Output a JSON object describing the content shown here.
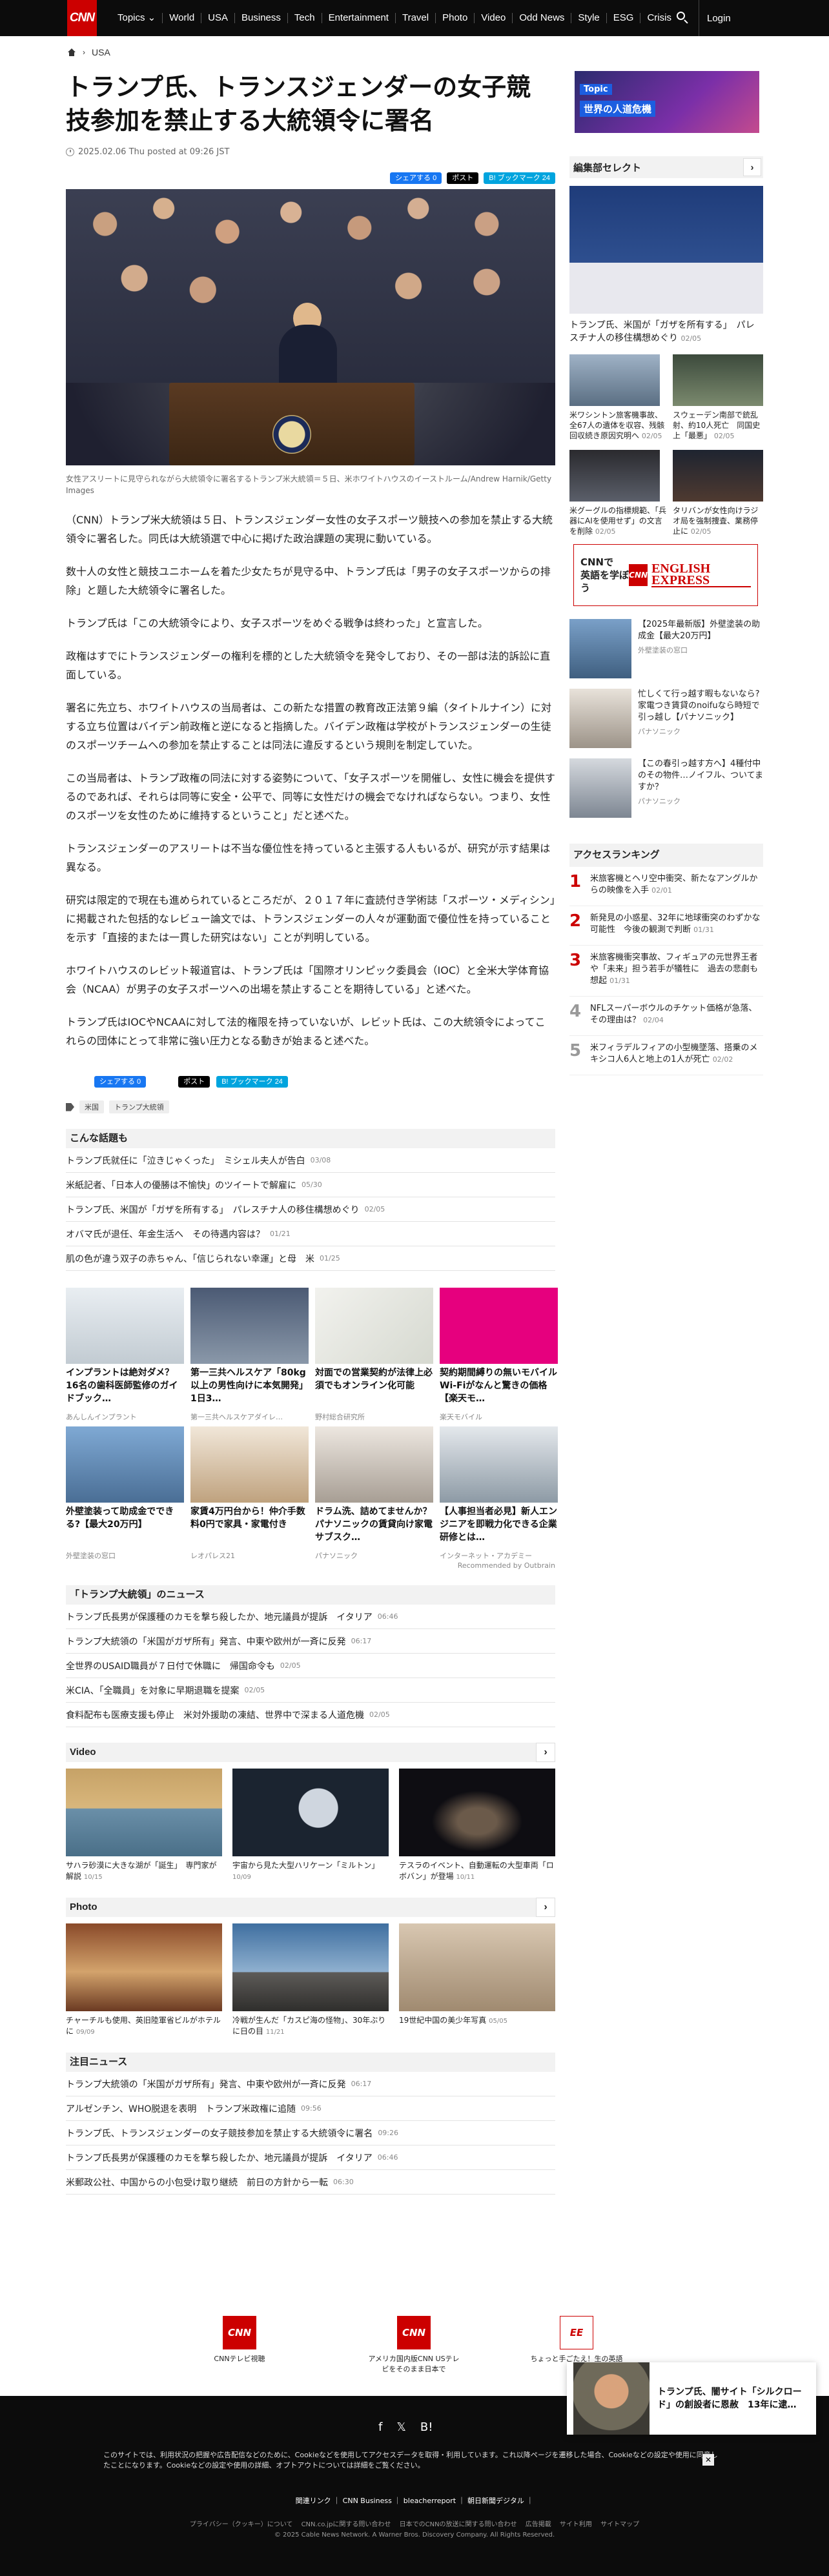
{
  "nav": {
    "logo": "CNN",
    "items": [
      "Topics ⌄",
      "World",
      "USA",
      "Business",
      "Tech",
      "Entertainment",
      "Travel",
      "Photo",
      "Video",
      "Odd News",
      "Style",
      "ESG",
      "Crisis"
    ],
    "login": "Login"
  },
  "breadcrumb": {
    "section": "USA"
  },
  "article": {
    "title": "トランプ氏、トランスジェンダーの女子競技参加を禁止する大統領令に署名",
    "date": "2025.02.06 Thu posted at 09:26 JST",
    "share": {
      "facebook": "シェアする 0",
      "x": "ポスト",
      "hatena": "B! ブックマーク 24"
    },
    "caption": "女性アスリートに見守られながら大統領令に署名するトランプ米大統領＝５日、米ホワイトハウスのイーストルーム/Andrew Harnik/Getty Images",
    "paragraphs": [
      "（CNN）トランプ米大統領は５日、トランスジェンダー女性の女子スポーツ競技への参加を禁止する大統領令に署名した。同氏は大統領選で中心に掲げた政治課題の実現に動いている。",
      "数十人の女性と競技ユニホームを着た少女たちが見守る中、トランプ氏は「男子の女子スポーツからの排除」と題した大統領令に署名した。",
      "トランプ氏は「この大統領令により、女子スポーツをめぐる戦争は終わった」と宣言した。",
      "政権はすでにトランスジェンダーの権利を標的とした大統領令を発令しており、その一部は法的訴訟に直面している。",
      "署名に先立ち、ホワイトハウスの当局者は、この新たな措置の教育改正法第９編（タイトルナイン）に対する立ち位置はバイデン前政権と逆になると指摘した。バイデン政権は学校がトランスジェンダーの生徒のスポーツチームへの参加を禁止することは同法に違反するという規則を制定していた。",
      "この当局者は、トランプ政権の同法に対する姿勢について、「女子スポーツを開催し、女性に機会を提供するのであれば、それらは同等に安全・公平で、同等に女性だけの機会でなければならない。つまり、女性のスポーツを女性のために維持するということ」だと述べた。",
      "トランスジェンダーのアスリートは不当な優位性を持っていると主張する人もいるが、研究が示す結果は異なる。",
      "研究は限定的で現在も進められているところだが、２０１７年に査読付き学術誌「スポーツ・メディシン」に掲載された包括的なレビュー論文では、トランスジェンダーの人々が運動面で優位性を持っていることを示す「直接的または一貫した研究はない」ことが判明している。",
      "ホワイトハウスのレビット報道官は、トランプ氏は「国際オリンピック委員会（IOC）と全米大学体育協会（NCAA）が男子の女子スポーツへの出場を禁止することを期待している」と述べた。",
      "トランプ氏はIOCやNCAAに対して法的権限を持っていないが、レビット氏は、この大統領令によってこれらの団体にとって非常に強い圧力となる動きが始まると述べた。"
    ],
    "share2": {
      "facebook": "シェアする 0",
      "x": "ポスト",
      "hatena": "B! ブックマーク 24"
    },
    "tags": [
      "米国",
      "トランプ大統領"
    ]
  },
  "popular": {
    "heading": "こんな話題も",
    "items": [
      {
        "text": "トランプ氏就任に「泣きじゃくった」　ミシェル夫人が告白",
        "date": "03/08"
      },
      {
        "text": "米紙記者、「日本人の優勝は不愉快」のツイートで解雇に",
        "date": "05/30"
      },
      {
        "text": "トランプ氏、米国が「ガザを所有する」　パレスチナ人の移住構想めぐり",
        "date": "02/05"
      },
      {
        "text": "オバマ氏が退任、年金生活へ　その待遇内容は？",
        "date": "01/21"
      },
      {
        "text": "肌の色が違う双子の赤ちゃん、「信じられない幸運」と母　米",
        "date": "01/25"
      }
    ]
  },
  "ads": [
    {
      "title": "インプラントは絶対ダメ？16名の歯科医師監修のガイドブック…",
      "sponsor": "あんしんインプラント"
    },
    {
      "title": "第一三共ヘルスケア「80kg以上の男性向けに本気開発」1日3…",
      "sponsor": "第一三共ヘルスケアダイレ…"
    },
    {
      "title": "対面での営業契約が法律上必須でもオンライン化可能",
      "sponsor": "野村総合研究所"
    },
    {
      "title": "契約期間縛りの無いモバイルWi-Fiがなんと驚きの価格【楽天モ…",
      "sponsor": "楽天モバイル"
    },
    {
      "title": "外壁塗装って助成金でできる?【最大20万円】",
      "sponsor": "外壁塗装の窓口"
    },
    {
      "title": "家賃4万円台から！仲介手数料0円で家具・家電付き",
      "sponsor": "レオパレス21"
    },
    {
      "title": "ドラム洗、詰めてませんか？パナソニックの賃貸向け家電サブスク…",
      "sponsor": "パナソニック"
    },
    {
      "title": "【人事担当者必見】新人エンジニアを即戦力化できる企業研修とは…",
      "sponsor": "インターネット・アカデミー"
    }
  ],
  "recommended_by": "Recommended by Outbrain",
  "series": {
    "heading": "「トランプ大統領」のニュース",
    "items": [
      {
        "text": "トランプ氏長男が保護種のカモを撃ち殺したか、地元議員が提訴　イタリア",
        "date": "06:46"
      },
      {
        "text": "トランプ大統領の「米国がガザ所有」発言、中東や欧州が一斉に反発",
        "date": "06:17"
      },
      {
        "text": "全世界のUSAID職員が７日付で休職に　帰国命令も",
        "date": "02/05"
      },
      {
        "text": "米CIA、「全職員」を対象に早期退職を提案",
        "date": "02/05"
      },
      {
        "text": "食料配布も医療支援も停止　米対外援助の凍結、世界中で深まる人道危機",
        "date": "02/05"
      }
    ]
  },
  "video": {
    "heading": "Video",
    "items": [
      {
        "title": "サハラ砂漠に大きな湖が「誕生」　専門家が解説",
        "date": "10/15"
      },
      {
        "title": "宇宙から見た大型ハリケーン「ミルトン」",
        "date": "10/09"
      },
      {
        "title": "テスラのイベント、自動運転の大型車両「ロボバン」が登場",
        "date": "10/11"
      }
    ]
  },
  "photo": {
    "heading": "Photo",
    "items": [
      {
        "title": "チャーチルも使用、英旧陸軍省ビルがホテルに",
        "date": "09/09"
      },
      {
        "title": "冷戦が生んだ「カスピ海の怪物」、30年ぶりに日の目",
        "date": "11/21"
      },
      {
        "title": "19世紀中国の美少年写真",
        "date": "05/05"
      }
    ]
  },
  "featured": {
    "heading": "注目ニュース",
    "items": [
      {
        "text": "トランプ大統領の「米国がガザ所有」発言、中東や欧州が一斉に反発",
        "date": "06:17"
      },
      {
        "text": "アルゼンチン、WHO脱退を表明　トランプ米政権に追随",
        "date": "09:56"
      },
      {
        "text": "トランプ氏、トランスジェンダーの女子競技参加を禁止する大統領令に署名",
        "date": "09:26"
      },
      {
        "text": "トランプ氏長男が保護種のカモを撃ち殺したか、地元議員が提訴　イタリア",
        "date": "06:46"
      },
      {
        "text": "米郵政公社、中国からの小包受け取り継続　前日の方針から一転",
        "date": "06:30"
      }
    ]
  },
  "sidebar": {
    "topic_label": "Topic",
    "topic_title": "世界の人道危機",
    "editor_heading": "編集部セレクト",
    "big_pick": {
      "title": "トランプ氏、米国が「ガザを所有する」　パレスチナ人の移住構想めぐり",
      "date": "02/05"
    },
    "picks": [
      {
        "title": "米ワシントン旅客機事故、全67人の遺体を収容、残骸回収続き原因究明へ",
        "date": "02/05"
      },
      {
        "title": "スウェーデン南部で銃乱射、約10人死亡　同国史上「最悪」",
        "date": "02/05"
      },
      {
        "title": "米グーグルの指標規範、「兵器にAIを使用せず」の文言を削除",
        "date": "02/05"
      },
      {
        "title": "タリバンが女性向けラジオ局を強制捜査、業務停止に",
        "date": "02/05"
      }
    ],
    "english_banner_l1": "CNNで",
    "english_banner_l2": "英語を学ぼう",
    "english_logo_cnn": "CNN",
    "english_logo_ee": "ENGLISH EXPRESS",
    "pr": [
      {
        "title": "【2025年最新版】外壁塗装の助成金【最大20万円】",
        "sponsor": "外壁塗装の窓口"
      },
      {
        "title": "忙しくて行っ越す暇もないなら?家電つき賃貸のnoifuなら時短で引っ越し【パナソニック】",
        "sponsor": "パナソニック"
      },
      {
        "title": "【この春引っ越す方へ】4種付中のその物件…ノイフル、ついてますか？",
        "sponsor": "パナソニック"
      }
    ],
    "ranking_heading": "アクセスランキング",
    "ranking": [
      {
        "n": "1",
        "title": "米旅客機とヘリ空中衝突、新たなアングルからの映像を入手",
        "date": "02/01"
      },
      {
        "n": "2",
        "title": "新発見の小惑星、32年に地球衝突のわずかな可能性　今後の観測で判断",
        "date": "01/31"
      },
      {
        "n": "3",
        "title": "米旅客機衝突事故、フィギュアの元世界王者や「未来」担う若手が犠牲に　過去の悲劇も想起",
        "date": "01/31"
      },
      {
        "n": "4",
        "title": "NFLスーパーボウルのチケット価格が急落、その理由は？",
        "date": "02/04"
      },
      {
        "n": "5",
        "title": "米フィラデルフィアの小型機墜落、搭乗のメキシコ人6人と地上の1人が死亡",
        "date": "02/02"
      }
    ]
  },
  "promo": [
    {
      "icon": "CNN",
      "label": "CNNテレビ視聴"
    },
    {
      "icon": "CNN",
      "label": "アメリカ国内版CNN USテレビをそのまま日本で"
    },
    {
      "icon": "EE",
      "label": "ちょっと手ごたえ！生の英語"
    }
  ],
  "floating": {
    "title": "トランプ氏、闇サイト「シルクロード」の創設者に恩赦　13年に逮…"
  },
  "footer": {
    "cookie_text": "このサイトでは、利用状況の把握や広告配信などのために、Cookieなどを使用してアクセスデータを取得・利用しています。これ以降ページを遷移した場合、Cookieなどの設定や使用に同意したことになります。Cookieなどの設定や使用の詳細、オプトアウトについては詳細をご覧ください。",
    "close": "✕",
    "links1": "関連リンク ｜ CNN Business ｜ bleacherreport ｜ 朝日新聞デジタル ｜",
    "links2": "プライバシー（クッキー）について　 CNN.co.jpに関する問い合わせ　 日本でのCNNの放送に関する問い合わせ　 広告掲載　 サイト利用　 サイトマップ",
    "copyright": "© 2025 Cable News Network. A Warner Bros. Discovery Company. All Rights Reserved."
  }
}
